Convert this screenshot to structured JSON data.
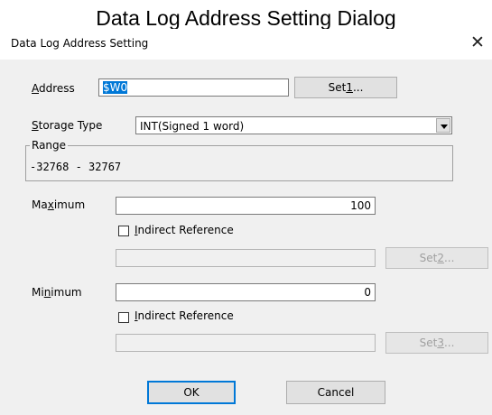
{
  "caption": "Data Log Address Setting Dialog",
  "dialog": {
    "title": "Data Log Address Setting",
    "address": {
      "label_pre": "",
      "label_u": "A",
      "label_post": "ddress",
      "value": "$W0",
      "set_button": {
        "pre": "Set",
        "u": "1",
        "post": "..."
      }
    },
    "storage_type": {
      "label_u": "S",
      "label_post": "torage Type",
      "selected": "INT(Signed 1 word)"
    },
    "range": {
      "legend": "Range",
      "value": "-32768 - 32767"
    },
    "maximum": {
      "label_pre": "Ma",
      "label_u": "x",
      "label_post": "imum",
      "value": "100",
      "indirect_label_u": "I",
      "indirect_label_post": "ndirect Reference",
      "indirect_checked": false,
      "set_button": {
        "pre": "Set",
        "u": "2",
        "post": "..."
      }
    },
    "minimum": {
      "label_pre": "Mi",
      "label_u": "n",
      "label_post": "imum",
      "value": "0",
      "indirect_label_u": "I",
      "indirect_label_post": "ndirect Reference",
      "indirect_checked": false,
      "set_button": {
        "pre": "Set",
        "u": "3",
        "post": "..."
      }
    },
    "ok_label": "OK",
    "cancel_label": "Cancel",
    "colors": {
      "selection": "#0078d7",
      "face": "#f0f0f0"
    }
  }
}
